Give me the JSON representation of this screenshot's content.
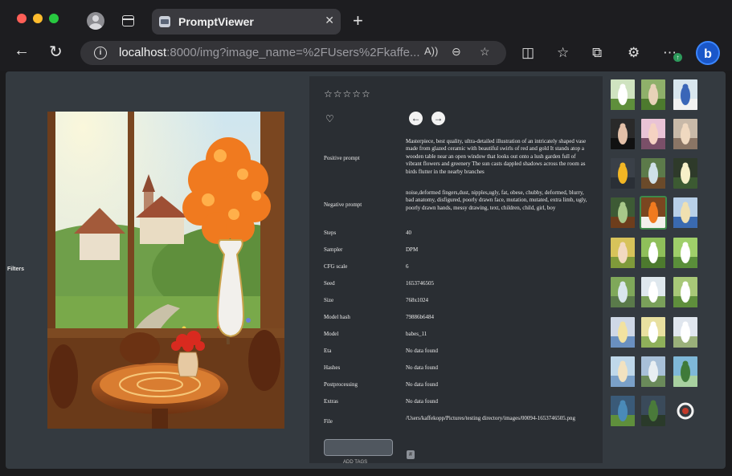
{
  "browser": {
    "tab_title": "PromptViewer",
    "url_host": "localhost",
    "url_rest": ":8000/img?image_name=%2FUsers%2Fkaffe...",
    "bing_label": "b"
  },
  "page": {
    "filters_label": "Filters",
    "rating_stars": "☆☆☆☆☆",
    "favorite_icon": "heart-outline-icon",
    "metadata": [
      {
        "key": "Positive prompt",
        "value": "Masterpiece, best quality, ultra-detailed illustration of an intricately shaped vase made from glazed ceramic with beautiful swirls of red and gold It stands atop a wooden table near an open window that looks out onto a lush garden full of vibrant flowers and greenery The sun casts dappled shadows across the room as birds flutter in the nearby branches"
      },
      {
        "key": "Negative prompt",
        "value": "noise,deformed fingers,dust, nipples,ugly, fat, obese, chubby, deformed, blurry, bad anatomy, disfigured, poorly drawn face, mutation, mutated, extra limb, ugly, poorly drawn hands, messy drawing, text, children, child, girl, boy"
      },
      {
        "key": "Steps",
        "value": "40"
      },
      {
        "key": "Sampler",
        "value": "DPM"
      },
      {
        "key": "CFG scale",
        "value": "6"
      },
      {
        "key": "Seed",
        "value": "1653746505"
      },
      {
        "key": "Size",
        "value": "768x1024"
      },
      {
        "key": "Model hash",
        "value": "79886b6484"
      },
      {
        "key": "Model",
        "value": "babes_11"
      },
      {
        "key": "Eta",
        "value": "No data found"
      },
      {
        "key": "Hashes",
        "value": "No data found"
      },
      {
        "key": "Postprocessing",
        "value": "No data found"
      },
      {
        "key": "Extras",
        "value": "No data found"
      },
      {
        "key": "File",
        "value": "/Users/kaffekopp/Pictures/testing directory/images/00094-1653746505.png"
      }
    ],
    "tag_label": "ADD TAGS"
  },
  "thumbnails": [
    {
      "subject": "woman in white dress, garden"
    },
    {
      "subject": "woman sitting in garden"
    },
    {
      "subject": "blue and white vase"
    },
    {
      "subject": "dark haired woman portrait"
    },
    {
      "subject": "woman in pink dress"
    },
    {
      "subject": "blonde woman portrait"
    },
    {
      "subject": "sunflower vase on table"
    },
    {
      "subject": "window with garden view"
    },
    {
      "subject": "window with sunlight"
    },
    {
      "subject": "garden window interior"
    },
    {
      "subject": "orange tree vase (selected)",
      "selected": true
    },
    {
      "subject": "blonde woman in blue"
    },
    {
      "subject": "woman sitting in sunny field"
    },
    {
      "subject": "woman in white on grass"
    },
    {
      "subject": "woman on golf course"
    },
    {
      "subject": "woman by water statue"
    },
    {
      "subject": "woman by fountain"
    },
    {
      "subject": "woman in meadow"
    },
    {
      "subject": "blonde woman with flowers"
    },
    {
      "subject": "woman in white dress field"
    },
    {
      "subject": "woman in white dress path"
    },
    {
      "subject": "woman with sky background"
    },
    {
      "subject": "landscape with clouds"
    },
    {
      "subject": "valley landscape"
    },
    {
      "subject": "blue vase with flowers"
    },
    {
      "subject": "tree vase on pedestal"
    },
    {
      "subject": "loading spinner"
    }
  ]
}
